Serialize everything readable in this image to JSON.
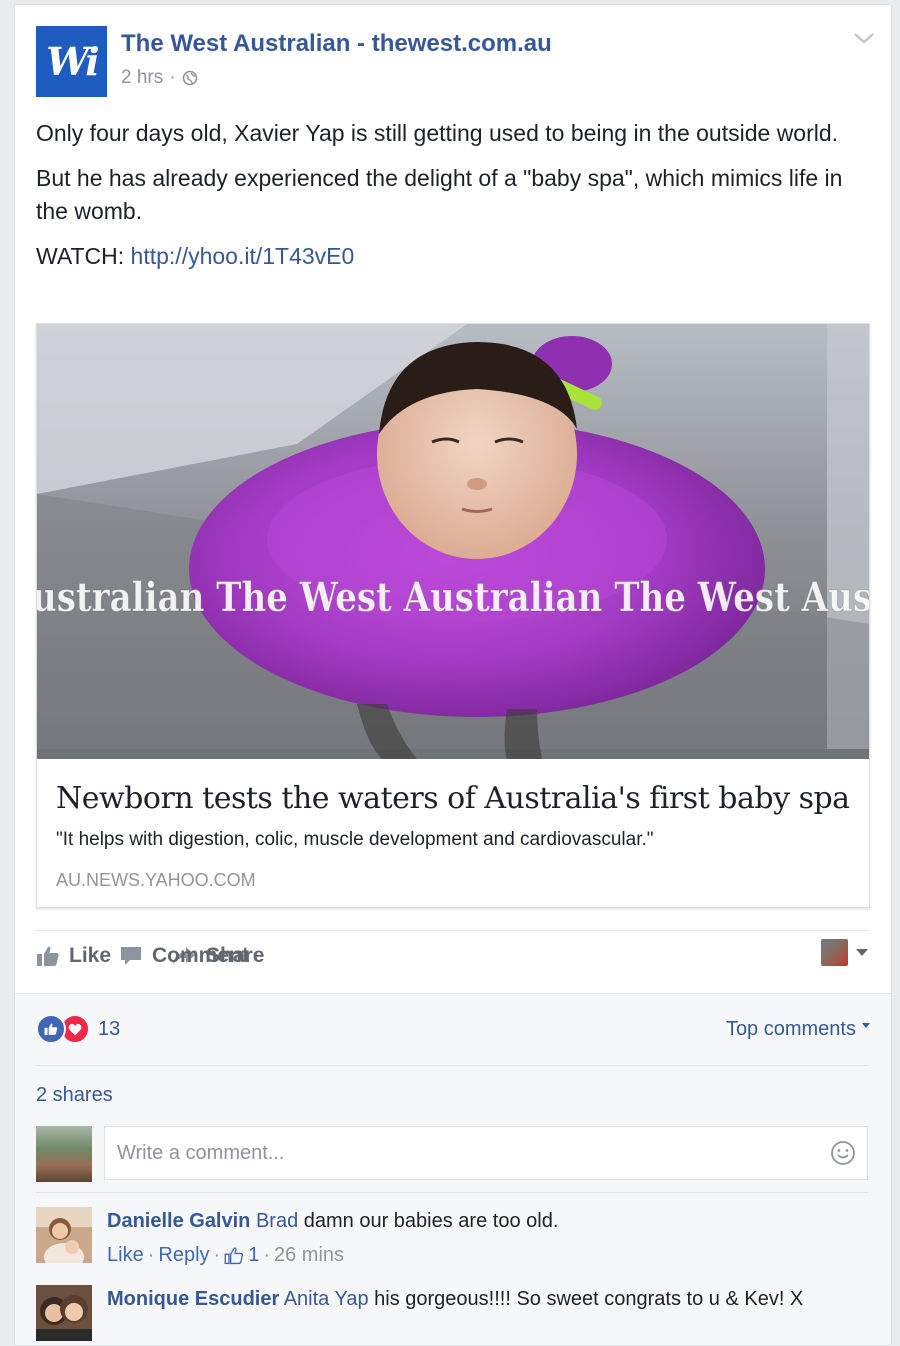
{
  "post": {
    "page_name": "The West Australian - thewest.com.au",
    "page_avatar_text": "Wi",
    "time": "2 hrs",
    "privacy_icon": "globe-icon",
    "paragraphs": [
      "Only four days old, Xavier Yap is still getting used to being in the outside world.",
      "But he has already experienced the delight of a \"baby spa\", which mimics life in the womb."
    ],
    "watch_label": "WATCH:",
    "watch_link": "http://yhoo.it/1T43vE0"
  },
  "link_card": {
    "image_watermark": "ustralian  The West Australian  The West Aus",
    "title": "Newborn tests the waters of Australia's first baby spa",
    "description": "\"It helps with digestion, colic, muscle development and cardiovascular.\"",
    "domain": "AU.NEWS.YAHOO.COM"
  },
  "actions": {
    "like": "Like",
    "comment": "Comment",
    "share": "Share"
  },
  "feedback": {
    "reaction_count": "13",
    "top_comments": "Top comments",
    "shares": "2 shares",
    "composer_placeholder": "Write a comment..."
  },
  "comments": [
    {
      "author": "Danielle Galvin",
      "tag": "Brad",
      "text": " damn our babies are too old.",
      "like": "Like",
      "reply": "Reply",
      "likes": "1",
      "time": "26 mins"
    },
    {
      "author": "Monique Escudier",
      "tag": "Anita Yap",
      "text": " his gorgeous!!!! So sweet congrats to u & Kev! X"
    }
  ],
  "colors": {
    "link": "#365899",
    "meta": "#90949c",
    "love": "#f0284a",
    "like": "#4267b2",
    "ring": "#b23fd0"
  }
}
